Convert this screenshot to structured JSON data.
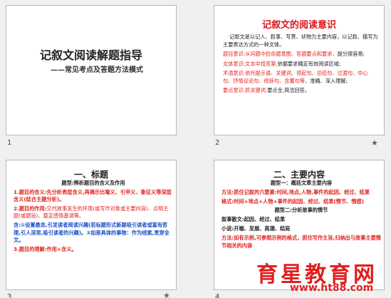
{
  "slides": [
    {
      "number": "1",
      "title": "记叙文阅读解题指导",
      "subtitle": "——常见考点及答题方法模式"
    },
    {
      "number": "2",
      "title": "记叙文的阅读意识",
      "intro": "记叙文是以记人、叙事、写景、状物为主要内容，以记叙、描写为主要表达方式的一种文体。",
      "lines": [
        {
          "lead": "题目意识:从问题中捡命题意图、答题要点和要求，",
          "rest": "提分很容易;"
        },
        {
          "lead": "文体意识:文本中找答案,",
          "rest": "依据要求确定有效阅读区域;"
        },
        {
          "lead": "术语意识:依托提示语、关键词、领起句、总结句、过渡句、中心句、抒情议论句、修辞句、含蓄句等，",
          "rest": "准确、深入理解;"
        },
        {
          "lead": "要点意识:抓关键词,",
          "rest": "要点全,简洁回答。"
        }
      ]
    },
    {
      "number": "3",
      "title": "一、标题",
      "subheading": "题型:辨析题目的含义及作用",
      "line1": "1.题目的含义:先分析表层含义,再揭示比喻义、引申义、象征义等深层含义(结合主题分析)。",
      "line2_head": "2.题目的作用:",
      "line2_body": "交代故事发生的环境(或写作对象或主要内容)、点明主题(或题旨)、奠定感情基调等。",
      "line3": "含:①设置悬念,引发读者阅读兴趣(若标题形式新颖吸引读者或富有哲理,引人深思,吸引读者的兴趣)。②如是具体的事物：作为线索,贯穿全文。",
      "line4": "3.题目的理解:作用+含义。"
    },
    {
      "number": "4",
      "title": "二、主要内容",
      "subheading1": "题型一：概括文章主要内容",
      "method1": "方法:抓住记叙的六要素:时间,地点,人物,事件的起因、经过、结果",
      "format1": "格式:时间+地点+人物+事件的起因、经过、结果(情节、情感)",
      "subheading2": "题型二:分析故事的情节",
      "line_a": "叙事散文:起因、经过、结果",
      "line_b": "小说:开端、发展、高潮、结局",
      "line_c": "方法:如有示例,可参照示例的格式，抓住写作主旨,归纳出与故事主要情节相关的内容"
    }
  ],
  "watermark": {
    "brand": "育星教育网",
    "url": "www.ht88.com"
  }
}
